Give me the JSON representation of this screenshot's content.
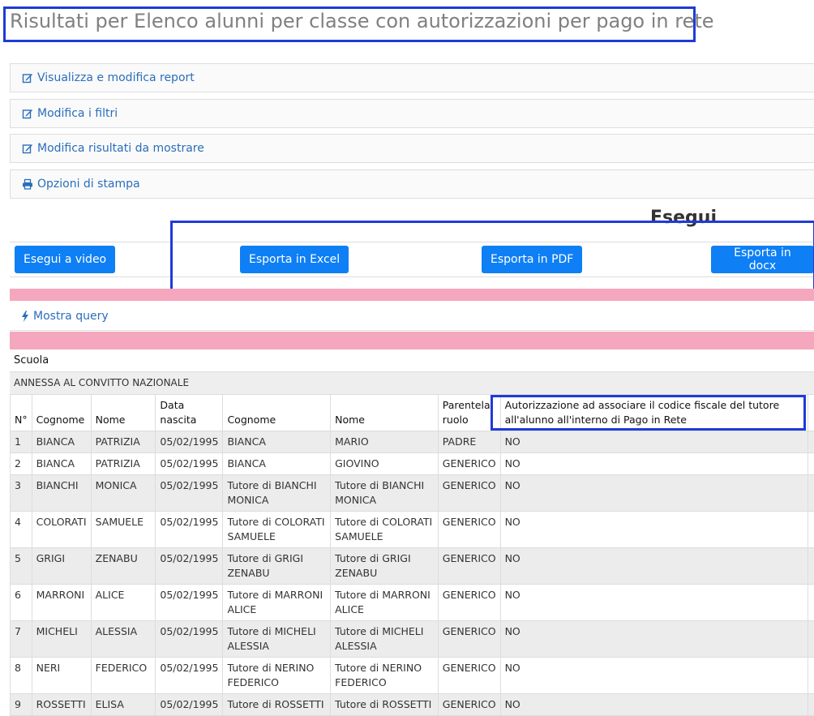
{
  "page": {
    "title": "Risultati per Elenco alunni per classe con autorizzazioni per pago in rete"
  },
  "panels": [
    {
      "label": "Visualizza e modifica report",
      "icon": "edit-icon"
    },
    {
      "label": "Modifica i filtri",
      "icon": "edit-icon"
    },
    {
      "label": "Modifica risultati da mostrare",
      "icon": "edit-icon"
    },
    {
      "label": "Opzioni di stampa",
      "icon": "print-icon"
    }
  ],
  "esegui": {
    "heading": "Esegui",
    "buttons": {
      "video": "Esegui a video",
      "excel": "Esporta in Excel",
      "pdf": "Esporta in PDF",
      "docx": "Esporta in docx"
    }
  },
  "query": {
    "label": "Mostra query",
    "icon": "bolt-icon"
  },
  "colors": {
    "accent": "#0e7ff5",
    "link": "#2a6ebb",
    "highlight": "#1f3bd6",
    "pink_band": "#f4a7bd"
  },
  "results": {
    "group_label": "Scuola",
    "group_value": "ANNESSA AL CONVITTO NAZIONALE",
    "headers": {
      "n": "N°",
      "cognome": "Cognome",
      "nome": "Nome",
      "data_nascita": "Data nascita",
      "tutore_cognome": "Cognome",
      "tutore_nome": "Nome",
      "parentela": "Parentela ruolo",
      "autorizzazione": "Autorizzazione ad associare il codice fiscale del tutore all'alunno all'interno di Pago in Rete"
    },
    "rows": [
      {
        "n": "1",
        "cognome": "BIANCA",
        "nome": "PATRIZIA",
        "data": "05/02/1995",
        "t_cognome": "BIANCA",
        "t_nome": "MARIO",
        "parentela": "PADRE",
        "aut": "NO"
      },
      {
        "n": "2",
        "cognome": "BIANCA",
        "nome": "PATRIZIA",
        "data": "05/02/1995",
        "t_cognome": "BIANCA",
        "t_nome": "GIOVINO",
        "parentela": "GENERICO",
        "aut": "NO"
      },
      {
        "n": "3",
        "cognome": "BIANCHI",
        "nome": "MONICA",
        "data": "05/02/1995",
        "t_cognome": "Tutore di BIANCHI MONICA",
        "t_nome": "Tutore di BIANCHI MONICA",
        "parentela": "GENERICO",
        "aut": "NO"
      },
      {
        "n": "4",
        "cognome": "COLORATI",
        "nome": "SAMUELE",
        "data": "05/02/1995",
        "t_cognome": "Tutore di COLORATI SAMUELE",
        "t_nome": "Tutore di COLORATI SAMUELE",
        "parentela": "GENERICO",
        "aut": "NO"
      },
      {
        "n": "5",
        "cognome": "GRIGI",
        "nome": "ZENABU",
        "data": "05/02/1995",
        "t_cognome": "Tutore di GRIGI ZENABU",
        "t_nome": "Tutore di GRIGI ZENABU",
        "parentela": "GENERICO",
        "aut": "NO"
      },
      {
        "n": "6",
        "cognome": "MARRONI",
        "nome": "ALICE",
        "data": "05/02/1995",
        "t_cognome": "Tutore di MARRONI ALICE",
        "t_nome": "Tutore di MARRONI ALICE",
        "parentela": "GENERICO",
        "aut": "NO"
      },
      {
        "n": "7",
        "cognome": "MICHELI",
        "nome": "ALESSIA",
        "data": "05/02/1995",
        "t_cognome": "Tutore di MICHELI ALESSIA",
        "t_nome": "Tutore di MICHELI ALESSIA",
        "parentela": "GENERICO",
        "aut": "NO"
      },
      {
        "n": "8",
        "cognome": "NERI",
        "nome": "FEDERICO",
        "data": "05/02/1995",
        "t_cognome": "Tutore di NERINO FEDERICO",
        "t_nome": "Tutore di NERINO FEDERICO",
        "parentela": "GENERICO",
        "aut": "NO"
      },
      {
        "n": "9",
        "cognome": "ROSSETTI",
        "nome": "ELISA",
        "data": "05/02/1995",
        "t_cognome": "Tutore di ROSSETTI",
        "t_nome": "Tutore di ROSSETTI",
        "parentela": "GENERICO",
        "aut": "NO"
      }
    ]
  }
}
